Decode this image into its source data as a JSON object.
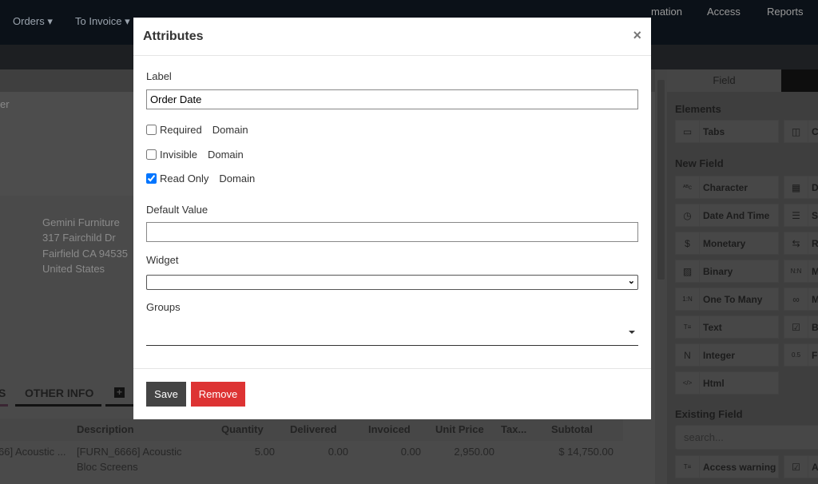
{
  "topnav": {
    "items": [
      "Orders",
      "To Invoice"
    ]
  },
  "subnav": {
    "items": [
      "mation",
      "Access",
      "Reports"
    ]
  },
  "form": {
    "partial_label": "er",
    "address": [
      "Gemini Furniture",
      "317 Fairchild Dr",
      "Fairfield CA 94535",
      "United States"
    ],
    "tabs": [
      "S",
      "OTHER INFO"
    ],
    "table": {
      "headers": [
        "Description",
        "Quantity",
        "Delivered",
        "Invoiced",
        "Unit Price",
        "Tax...",
        "Subtotal"
      ],
      "row": {
        "product": "66] Acoustic ...",
        "description_1": "[FURN_6666] Acoustic",
        "description_2": "Bloc Screens",
        "quantity": "5.00",
        "delivered": "0.00",
        "invoiced": "0.00",
        "unit_price": "2,950.00",
        "subtotal": "$ 14,750.00"
      }
    }
  },
  "panel": {
    "tab": "Field",
    "elements_title": "Elements",
    "elements": [
      {
        "label": "Tabs",
        "icon": "tabs-icon"
      },
      {
        "label": "Co",
        "icon": "columns-icon"
      }
    ],
    "new_field_title": "New Field",
    "new_fields": [
      {
        "label": "Character",
        "icon": "abc-icon"
      },
      {
        "label": "Da",
        "icon": "calendar-icon"
      },
      {
        "label": "Date And Time",
        "icon": "calendar-clock-icon"
      },
      {
        "label": "Se",
        "icon": "selection-icon"
      },
      {
        "label": "Monetary",
        "icon": "money-icon"
      },
      {
        "label": "Re",
        "icon": "link-icon"
      },
      {
        "label": "Binary",
        "icon": "image-icon"
      },
      {
        "label": "Ma",
        "icon": "many2many-icon"
      },
      {
        "label": "One To Many",
        "icon": "one2many-icon"
      },
      {
        "label": "Ma",
        "icon": "chain-icon"
      },
      {
        "label": "Text",
        "icon": "text-icon"
      },
      {
        "label": "Bo",
        "icon": "checkbox-icon"
      },
      {
        "label": "Integer",
        "icon": "integer-icon"
      },
      {
        "label": "Fl",
        "icon": "float-icon"
      },
      {
        "label": "Html",
        "icon": "html-icon"
      }
    ],
    "existing_title": "Existing Field",
    "search_placeholder": "search...",
    "existing": [
      {
        "label": "Access warning",
        "icon": "text-icon"
      },
      {
        "label": "Ac",
        "icon": "checkbox-icon"
      }
    ]
  },
  "modal": {
    "title": "Attributes",
    "close": "×",
    "label_label": "Label",
    "label_value": "Order Date",
    "required": {
      "label": "Required",
      "checked": false,
      "domain": "Domain"
    },
    "invisible": {
      "label": "Invisible",
      "checked": false,
      "domain": "Domain"
    },
    "readonly": {
      "label": "Read Only",
      "checked": true,
      "domain": "Domain"
    },
    "default_label": "Default Value",
    "default_value": "",
    "widget_label": "Widget",
    "widget_value": "",
    "groups_label": "Groups",
    "save": "Save",
    "remove": "Remove",
    "colors": {
      "save": "#444444",
      "remove": "#dd3333"
    }
  }
}
